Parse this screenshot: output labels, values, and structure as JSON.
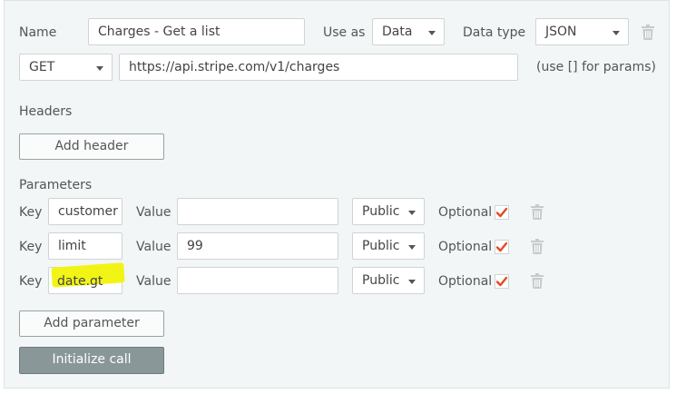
{
  "top": {
    "name_label": "Name",
    "name_value": "Charges - Get a list",
    "use_as_label": "Use as",
    "use_as_value": "Data",
    "data_type_label": "Data type",
    "data_type_value": "JSON"
  },
  "request": {
    "method": "GET",
    "url": "https://api.stripe.com/v1/charges",
    "hint": "(use [] for params)"
  },
  "headers": {
    "section_label": "Headers",
    "add_label": "Add header"
  },
  "parameters": {
    "section_label": "Parameters",
    "key_label": "Key",
    "value_label": "Value",
    "optional_label": "Optional",
    "rows": [
      {
        "key": "customer",
        "value": "",
        "visibility": "Public",
        "optional": true
      },
      {
        "key": "limit",
        "value": "99",
        "visibility": "Public",
        "optional": true
      },
      {
        "key": "date.gt",
        "value": "",
        "visibility": "Public",
        "optional": true
      }
    ],
    "add_label": "Add parameter"
  },
  "actions": {
    "initialize_label": "Initialize call"
  },
  "colors": {
    "panel_bg": "#f2f6f6",
    "check_red": "#e24b26",
    "primary_button": "#8a9799",
    "highlight": "#f1f30a"
  },
  "icons": {
    "delete": "trash-icon",
    "checkbox": "checkmark-icon",
    "dropdown": "chevron-down-icon"
  }
}
